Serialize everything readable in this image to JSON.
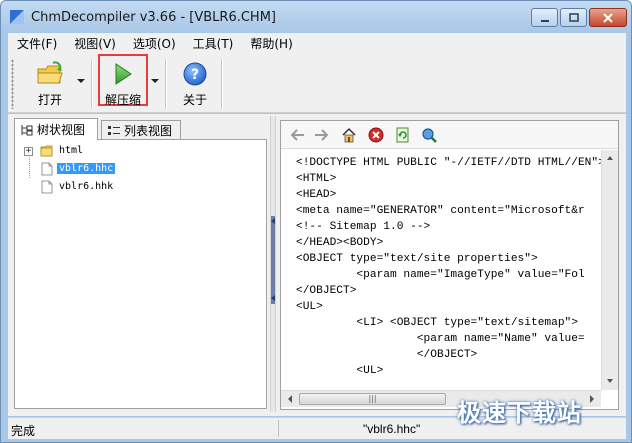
{
  "window": {
    "title": "ChmDecompiler v3.66 - [VBLR6.CHM]"
  },
  "menu": [
    "文件(F)",
    "视图(V)",
    "选项(O)",
    "工具(T)",
    "帮助(H)"
  ],
  "toolbar": {
    "open_label": "打开",
    "decompress_label": "解压缩",
    "about_label": "关于"
  },
  "tabs": {
    "tree": "树状视图",
    "list": "列表视图"
  },
  "tree": {
    "items": [
      {
        "label": "html",
        "kind": "folder"
      },
      {
        "label": "vblr6.hhc",
        "kind": "file",
        "selected": true
      },
      {
        "label": "vblr6.hhk",
        "kind": "file"
      }
    ]
  },
  "viewer": {
    "lines": [
      "<!DOCTYPE HTML PUBLIC \"-//IETF//DTD HTML//EN\">",
      "<HTML>",
      "<HEAD>",
      "<meta name=\"GENERATOR\" content=\"Microsoft&r",
      "<!-- Sitemap 1.0 -->",
      "</HEAD><BODY>",
      "<OBJECT type=\"text/site properties\">",
      "         <param name=\"ImageType\" value=\"Fol",
      "</OBJECT>",
      "<UL>",
      "         <LI> <OBJECT type=\"text/sitemap\">",
      "                  <param name=\"Name\" value=",
      "                  </OBJECT>",
      "         <UL>"
    ],
    "hscroll_thumb": "|||"
  },
  "status": {
    "left": "完成",
    "file": "\"vblr6.hhc\""
  },
  "watermark": "极速下载站",
  "colors": {
    "accent": "#3399ff",
    "highlight": "#e53c3c",
    "titlebar": "#a9c7e6"
  }
}
